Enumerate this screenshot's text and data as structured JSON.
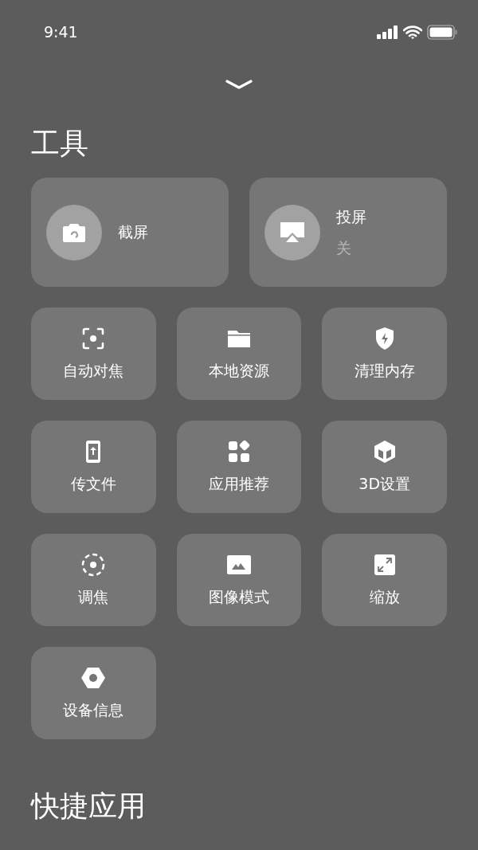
{
  "status_bar": {
    "time": "9:41"
  },
  "tools": {
    "title": "工具",
    "large_tiles": [
      {
        "label": "截屏"
      },
      {
        "label": "投屏",
        "status": "关"
      }
    ],
    "tiles": [
      {
        "label": "自动对焦"
      },
      {
        "label": "本地资源"
      },
      {
        "label": "清理内存"
      },
      {
        "label": "传文件"
      },
      {
        "label": "应用推荐"
      },
      {
        "label": "3D设置"
      },
      {
        "label": "调焦"
      },
      {
        "label": "图像模式"
      },
      {
        "label": "缩放"
      },
      {
        "label": "设备信息"
      }
    ]
  },
  "quick_apps": {
    "title": "快捷应用"
  }
}
